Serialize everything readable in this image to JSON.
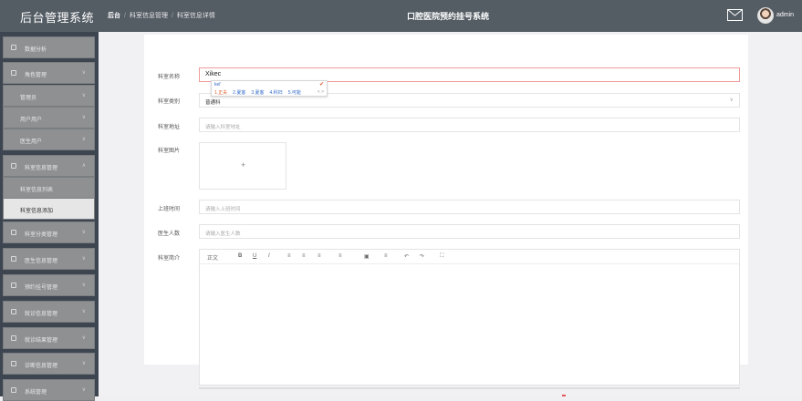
{
  "header": {
    "app_title": "后台管理系统",
    "breadcrumb": [
      "后台",
      "科室信息管理",
      "科室信息详情"
    ],
    "system_title": "口腔医院预约挂号系统",
    "user_name": "admin"
  },
  "sidebar": {
    "items": [
      {
        "label": "数据分析",
        "icon": "home-icon"
      },
      {
        "label": "角色管理",
        "icon": "user-group-icon"
      },
      {
        "label": "管理员",
        "sub": true
      },
      {
        "label": "用户用户",
        "sub": true
      },
      {
        "label": "医生用户",
        "sub": true
      },
      {
        "label": "科室信息管理",
        "icon": "grid-icon",
        "expanded": true
      },
      {
        "label": "科室信息列表",
        "sub": true
      },
      {
        "label": "科室信息添加",
        "sub": true,
        "active": true
      },
      {
        "label": "科室分类管理",
        "icon": "list-icon"
      },
      {
        "label": "医生信息管理",
        "icon": "calendar-icon"
      },
      {
        "label": "预约挂号管理",
        "icon": "person-icon"
      },
      {
        "label": "就诊信息管理",
        "icon": "apps-icon"
      },
      {
        "label": "就诊结果管理",
        "icon": "document-icon"
      },
      {
        "label": "诊断信息管理",
        "icon": "gear-icon"
      },
      {
        "label": "系统管理",
        "icon": "settings-icon"
      }
    ]
  },
  "form": {
    "name_label": "科室名称",
    "name_value": "Xikec",
    "category_label": "科室类别",
    "category_value": "普通科",
    "location_label": "科室地址",
    "location_placeholder": "请输入科室地址",
    "image_label": "科室图片",
    "upload_plus": "+",
    "hours_label": "上班时间",
    "hours_placeholder": "请输入上班时间",
    "count_label": "医生人数",
    "count_placeholder": "请输入医生人数",
    "intro_label": "科室简介"
  },
  "ime": {
    "code": "kei'",
    "candidates": [
      "1.正夫",
      "2.夏客",
      "3.夏客",
      "4.科妇",
      "5.可能"
    ],
    "more": "< >"
  },
  "editor_toolbar": [
    "正文",
    "B",
    "U",
    "I",
    "≡",
    "≡",
    "≡",
    "≡",
    "▣",
    "≡",
    "↶",
    "↷",
    "⛶"
  ],
  "colors": {
    "topbar": "#545c64",
    "sidebar": "#3d4550",
    "accent_red": "#ee9c9c"
  }
}
